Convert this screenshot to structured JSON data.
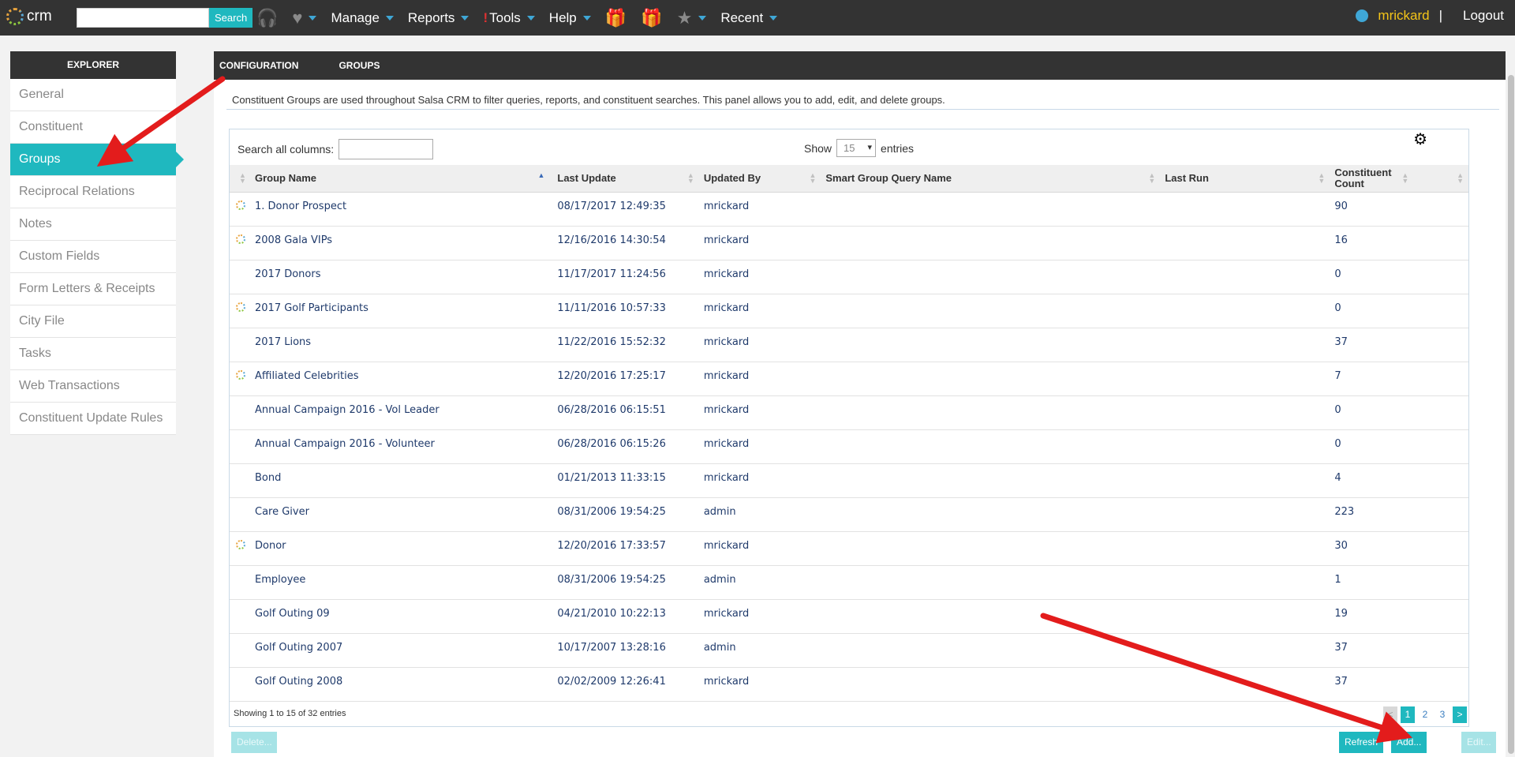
{
  "topbar": {
    "logo_text": "crm",
    "search_placeholder": "",
    "search_button": "Search",
    "nav": [
      {
        "label": "Manage"
      },
      {
        "label": "Reports"
      },
      {
        "label": "Tools"
      },
      {
        "label": "Help"
      },
      {
        "label": "Recent"
      }
    ],
    "username": "mrickard",
    "separator": "|",
    "logout": "Logout"
  },
  "sidebar": {
    "header": "EXPLORER",
    "items": [
      {
        "label": "General"
      },
      {
        "label": "Constituent"
      },
      {
        "label": "Groups"
      },
      {
        "label": "Reciprocal Relations"
      },
      {
        "label": "Notes"
      },
      {
        "label": "Custom Fields"
      },
      {
        "label": "Form Letters & Receipts"
      },
      {
        "label": "City File"
      },
      {
        "label": "Tasks"
      },
      {
        "label": "Web Transactions"
      },
      {
        "label": "Constituent Update Rules"
      }
    ],
    "active_index": 2
  },
  "panel": {
    "tabs": [
      "CONFIGURATION",
      "GROUPS"
    ],
    "description": "Constituent Groups are used throughout Salsa CRM to filter queries, reports, and constituent searches. This panel allows you to add, edit, and delete groups.",
    "filter_label": "Search all columns:",
    "filter_value": "",
    "show_label": "Show",
    "show_value": "15",
    "entries_label": "entries",
    "columns": [
      "Group Name",
      "Last Update",
      "Updated By",
      "Smart Group Query Name",
      "Last Run",
      "Constituent Count"
    ],
    "rows": [
      {
        "smart": true,
        "name": "1. Donor Prospect",
        "updated": "08/17/2017 12:49:35",
        "by": "mrickard",
        "query": "",
        "last_run": "",
        "count": "90"
      },
      {
        "smart": true,
        "name": "2008 Gala VIPs",
        "updated": "12/16/2016 14:30:54",
        "by": "mrickard",
        "query": "",
        "last_run": "",
        "count": "16"
      },
      {
        "smart": false,
        "name": "2017 Donors",
        "updated": "11/17/2017 11:24:56",
        "by": "mrickard",
        "query": "",
        "last_run": "",
        "count": "0"
      },
      {
        "smart": true,
        "name": "2017 Golf Participants",
        "updated": "11/11/2016 10:57:33",
        "by": "mrickard",
        "query": "",
        "last_run": "",
        "count": "0"
      },
      {
        "smart": false,
        "name": "2017 Lions",
        "updated": "11/22/2016 15:52:32",
        "by": "mrickard",
        "query": "",
        "last_run": "",
        "count": "37"
      },
      {
        "smart": true,
        "name": "Affiliated Celebrities",
        "updated": "12/20/2016 17:25:17",
        "by": "mrickard",
        "query": "",
        "last_run": "",
        "count": "7"
      },
      {
        "smart": false,
        "name": "Annual Campaign 2016 - Vol Leader",
        "updated": "06/28/2016 06:15:51",
        "by": "mrickard",
        "query": "",
        "last_run": "",
        "count": "0"
      },
      {
        "smart": false,
        "name": "Annual Campaign 2016 - Volunteer",
        "updated": "06/28/2016 06:15:26",
        "by": "mrickard",
        "query": "",
        "last_run": "",
        "count": "0"
      },
      {
        "smart": false,
        "name": "Bond",
        "updated": "01/21/2013 11:33:15",
        "by": "mrickard",
        "query": "",
        "last_run": "",
        "count": "4"
      },
      {
        "smart": false,
        "name": "Care Giver",
        "updated": "08/31/2006 19:54:25",
        "by": "admin",
        "query": "",
        "last_run": "",
        "count": "223"
      },
      {
        "smart": true,
        "name": "Donor",
        "updated": "12/20/2016 17:33:57",
        "by": "mrickard",
        "query": "",
        "last_run": "",
        "count": "30"
      },
      {
        "smart": false,
        "name": "Employee",
        "updated": "08/31/2006 19:54:25",
        "by": "admin",
        "query": "",
        "last_run": "",
        "count": "1"
      },
      {
        "smart": false,
        "name": "Golf Outing 09",
        "updated": "04/21/2010 10:22:13",
        "by": "mrickard",
        "query": "",
        "last_run": "",
        "count": "19"
      },
      {
        "smart": false,
        "name": "Golf Outing 2007",
        "updated": "10/17/2007 13:28:16",
        "by": "admin",
        "query": "",
        "last_run": "",
        "count": "37"
      },
      {
        "smart": false,
        "name": "Golf Outing 2008",
        "updated": "02/02/2009 12:26:41",
        "by": "mrickard",
        "query": "",
        "last_run": "",
        "count": "37"
      }
    ],
    "info": "Showing 1 to 15 of 32 entries",
    "pagination": {
      "prev": "<",
      "pages": [
        "1",
        "2",
        "3"
      ],
      "current": "1",
      "next": ">"
    },
    "buttons": {
      "delete": "Delete...",
      "refresh": "Refresh",
      "add": "Add...",
      "edit": "Edit..."
    }
  },
  "colors": {
    "accent": "#1fb8bf",
    "topbar": "#333333",
    "arrow": "#e31c1c",
    "username": "#f5c518"
  }
}
